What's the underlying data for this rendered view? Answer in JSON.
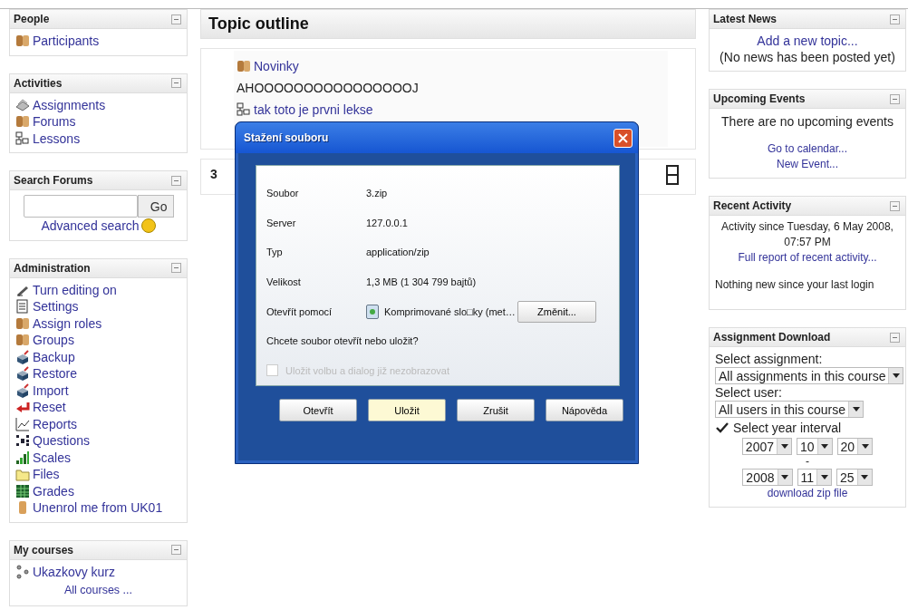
{
  "left_blocks": [
    {
      "kind": "list",
      "title": "People",
      "items": [
        {
          "label": "Participants"
        }
      ]
    },
    {
      "kind": "list",
      "title": "Activities",
      "items": [
        {
          "label": "Assignments"
        },
        {
          "label": "Forums"
        },
        {
          "label": "Lessons"
        }
      ]
    },
    {
      "kind": "search",
      "title": "Search Forums",
      "button": "Go",
      "link": "Advanced search"
    },
    {
      "kind": "list",
      "title": "Administration",
      "items": [
        {
          "label": "Turn editing on"
        },
        {
          "label": "Settings"
        },
        {
          "label": "Assign roles"
        },
        {
          "label": "Groups"
        },
        {
          "label": "Backup"
        },
        {
          "label": "Restore"
        },
        {
          "label": "Import"
        },
        {
          "label": "Reset"
        },
        {
          "label": "Reports"
        },
        {
          "label": "Questions"
        },
        {
          "label": "Scales"
        },
        {
          "label": "Files"
        },
        {
          "label": "Grades"
        },
        {
          "label": "Unenrol me from UK01"
        }
      ]
    },
    {
      "kind": "courses",
      "title": "My courses",
      "items": [
        {
          "label": "Ukazkovy kurz"
        }
      ],
      "link": "All courses ..."
    }
  ],
  "topic_outline": {
    "title": "Topic outline",
    "section_0": [
      {
        "kind": "forum",
        "label": "Novinky"
      },
      {
        "kind": "text",
        "label": "AHOOOOOOOOOOOOOOOOJ"
      },
      {
        "kind": "lesson",
        "label": "tak toto je prvni lekse"
      }
    ],
    "section_3": {
      "number": "3"
    }
  },
  "dialog": {
    "title": "Stažení souboru",
    "fields": [
      {
        "label": "Soubor",
        "value": "3.zip"
      },
      {
        "label": "Server",
        "value": "127.0.0.1"
      },
      {
        "label": "Typ",
        "value": "application/zip"
      },
      {
        "label": "Velikost",
        "value": "1,3 MB (1 304 799 bajtů)"
      }
    ],
    "open_with": {
      "label": "Otevřít pomocí",
      "value": "Komprimované slo□ky (met…",
      "button": "Změnit..."
    },
    "question": "Chcete soubor otevřít nebo uložit?",
    "remember": {
      "label": "Uložit volbu a dialog již nezobrazovat",
      "checked": false,
      "disabled": true
    },
    "buttons": [
      {
        "label": "Otevřít",
        "selected": false
      },
      {
        "label": "Uložit",
        "selected": true
      },
      {
        "label": "Zrušit",
        "selected": false
      },
      {
        "label": "Nápověda",
        "selected": false
      }
    ]
  },
  "latest_news": {
    "title": "Latest News",
    "link": "Add a new topic...",
    "note": "(No news has been posted yet)"
  },
  "upcoming_events": {
    "title": "Upcoming Events",
    "note": "There are no upcoming events",
    "links": [
      "Go to calendar...",
      "New Event..."
    ]
  },
  "recent_activity": {
    "title": "Recent Activity",
    "since": "Activity since Tuesday, 6 May 2008, 07:57 PM",
    "link": "Full report of recent activity...",
    "note": "Nothing new since your last login"
  },
  "assignment_download": {
    "title": "Assignment Download",
    "assignment_label": "Select assignment:",
    "assignment": "All assignments in this course",
    "user_label": "Select user:",
    "user": "All users in this course",
    "interval": {
      "label": "Select year interval",
      "checked": true
    },
    "from": [
      "2007",
      "10",
      "20"
    ],
    "separator": "-",
    "to": [
      "2008",
      "11",
      "25"
    ],
    "link": "download zip file"
  }
}
